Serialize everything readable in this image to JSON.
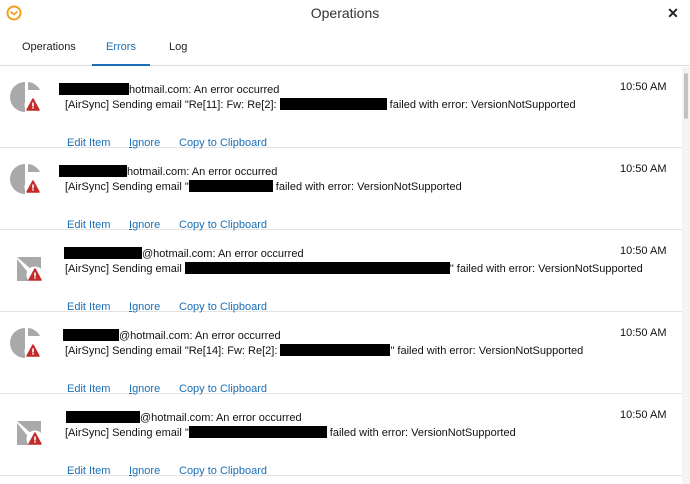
{
  "window": {
    "title": "Operations",
    "close_glyph": "✕",
    "app_icon": "emclient-icon"
  },
  "tabs": [
    {
      "label": "Operations",
      "active": false
    },
    {
      "label": "Errors",
      "active": true
    },
    {
      "label": "Log",
      "active": false
    }
  ],
  "colors": {
    "accent": "#1a6fb7",
    "error_badge": "#c42b2b"
  },
  "items": [
    {
      "avatar": "contact-avatar",
      "sender_suffix": "hotmail.com: An error occurred",
      "detail_prefix": "[AirSync] Sending email \"Re[11]: Fw: Re[2]: ",
      "detail_suffix": " failed with error: VersionNotSupported",
      "time": "10:50 AM",
      "actions": {
        "edit": "Edit Item",
        "ignore": "Ignore",
        "copy": "Copy to Clipboard"
      }
    },
    {
      "avatar": "contact-avatar",
      "sender_suffix": "hotmail.com: An error occurred",
      "detail_prefix": "[AirSync] Sending email \"",
      "detail_suffix": " failed with error: VersionNotSupported",
      "time": "10:50 AM",
      "actions": {
        "edit": "Edit Item",
        "ignore": "Ignore",
        "copy": "Copy to Clipboard"
      }
    },
    {
      "avatar": "email-avatar",
      "sender_suffix": "@hotmail.com: An error occurred",
      "detail_prefix": "[AirSync] Sending email ",
      "detail_suffix": "\" failed with error: VersionNotSupported",
      "time": "10:50 AM",
      "actions": {
        "edit": "Edit Item",
        "ignore": "Ignore",
        "copy": "Copy to Clipboard"
      }
    },
    {
      "avatar": "contact-avatar",
      "sender_suffix": "@hotmail.com: An error occurred",
      "detail_prefix": "[AirSync] Sending email \"Re[14]: Fw: Re[2]: ",
      "detail_suffix": "\" failed with error: VersionNotSupported",
      "time": "10:50 AM",
      "actions": {
        "edit": "Edit Item",
        "ignore": "Ignore",
        "copy": "Copy to Clipboard"
      }
    },
    {
      "avatar": "email-avatar",
      "sender_suffix": "@hotmail.com: An error occurred",
      "detail_prefix": "[AirSync] Sending email \"",
      "detail_suffix": " failed with error: VersionNotSupported",
      "time": "10:50 AM",
      "actions": {
        "edit": "Edit Item",
        "ignore": "Ignore",
        "copy": "Copy to Clipboard"
      }
    }
  ]
}
